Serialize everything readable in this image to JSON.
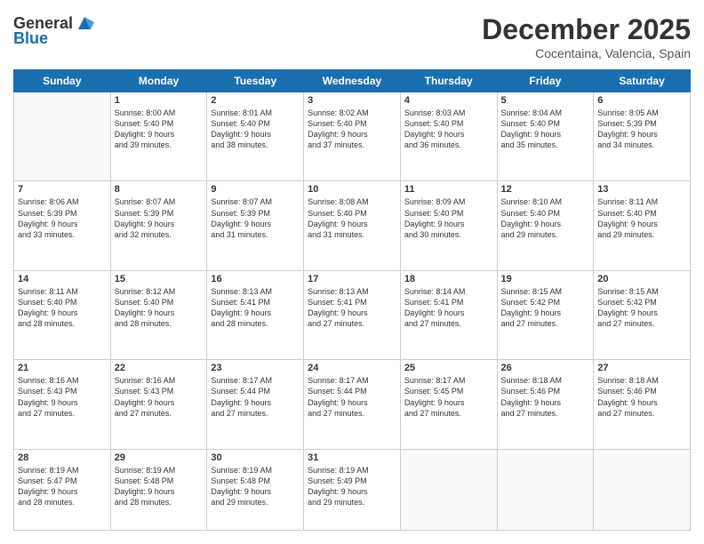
{
  "header": {
    "logo_general": "General",
    "logo_blue": "Blue",
    "month_title": "December 2025",
    "location": "Cocentaina, Valencia, Spain"
  },
  "days_of_week": [
    "Sunday",
    "Monday",
    "Tuesday",
    "Wednesday",
    "Thursday",
    "Friday",
    "Saturday"
  ],
  "weeks": [
    [
      {
        "day": "",
        "info": ""
      },
      {
        "day": "1",
        "info": "Sunrise: 8:00 AM\nSunset: 5:40 PM\nDaylight: 9 hours\nand 39 minutes."
      },
      {
        "day": "2",
        "info": "Sunrise: 8:01 AM\nSunset: 5:40 PM\nDaylight: 9 hours\nand 38 minutes."
      },
      {
        "day": "3",
        "info": "Sunrise: 8:02 AM\nSunset: 5:40 PM\nDaylight: 9 hours\nand 37 minutes."
      },
      {
        "day": "4",
        "info": "Sunrise: 8:03 AM\nSunset: 5:40 PM\nDaylight: 9 hours\nand 36 minutes."
      },
      {
        "day": "5",
        "info": "Sunrise: 8:04 AM\nSunset: 5:40 PM\nDaylight: 9 hours\nand 35 minutes."
      },
      {
        "day": "6",
        "info": "Sunrise: 8:05 AM\nSunset: 5:39 PM\nDaylight: 9 hours\nand 34 minutes."
      }
    ],
    [
      {
        "day": "7",
        "info": "Sunrise: 8:06 AM\nSunset: 5:39 PM\nDaylight: 9 hours\nand 33 minutes."
      },
      {
        "day": "8",
        "info": "Sunrise: 8:07 AM\nSunset: 5:39 PM\nDaylight: 9 hours\nand 32 minutes."
      },
      {
        "day": "9",
        "info": "Sunrise: 8:07 AM\nSunset: 5:39 PM\nDaylight: 9 hours\nand 31 minutes."
      },
      {
        "day": "10",
        "info": "Sunrise: 8:08 AM\nSunset: 5:40 PM\nDaylight: 9 hours\nand 31 minutes."
      },
      {
        "day": "11",
        "info": "Sunrise: 8:09 AM\nSunset: 5:40 PM\nDaylight: 9 hours\nand 30 minutes."
      },
      {
        "day": "12",
        "info": "Sunrise: 8:10 AM\nSunset: 5:40 PM\nDaylight: 9 hours\nand 29 minutes."
      },
      {
        "day": "13",
        "info": "Sunrise: 8:11 AM\nSunset: 5:40 PM\nDaylight: 9 hours\nand 29 minutes."
      }
    ],
    [
      {
        "day": "14",
        "info": "Sunrise: 8:11 AM\nSunset: 5:40 PM\nDaylight: 9 hours\nand 28 minutes."
      },
      {
        "day": "15",
        "info": "Sunrise: 8:12 AM\nSunset: 5:40 PM\nDaylight: 9 hours\nand 28 minutes."
      },
      {
        "day": "16",
        "info": "Sunrise: 8:13 AM\nSunset: 5:41 PM\nDaylight: 9 hours\nand 28 minutes."
      },
      {
        "day": "17",
        "info": "Sunrise: 8:13 AM\nSunset: 5:41 PM\nDaylight: 9 hours\nand 27 minutes."
      },
      {
        "day": "18",
        "info": "Sunrise: 8:14 AM\nSunset: 5:41 PM\nDaylight: 9 hours\nand 27 minutes."
      },
      {
        "day": "19",
        "info": "Sunrise: 8:15 AM\nSunset: 5:42 PM\nDaylight: 9 hours\nand 27 minutes."
      },
      {
        "day": "20",
        "info": "Sunrise: 8:15 AM\nSunset: 5:42 PM\nDaylight: 9 hours\nand 27 minutes."
      }
    ],
    [
      {
        "day": "21",
        "info": "Sunrise: 8:16 AM\nSunset: 5:43 PM\nDaylight: 9 hours\nand 27 minutes."
      },
      {
        "day": "22",
        "info": "Sunrise: 8:16 AM\nSunset: 5:43 PM\nDaylight: 9 hours\nand 27 minutes."
      },
      {
        "day": "23",
        "info": "Sunrise: 8:17 AM\nSunset: 5:44 PM\nDaylight: 9 hours\nand 27 minutes."
      },
      {
        "day": "24",
        "info": "Sunrise: 8:17 AM\nSunset: 5:44 PM\nDaylight: 9 hours\nand 27 minutes."
      },
      {
        "day": "25",
        "info": "Sunrise: 8:17 AM\nSunset: 5:45 PM\nDaylight: 9 hours\nand 27 minutes."
      },
      {
        "day": "26",
        "info": "Sunrise: 8:18 AM\nSunset: 5:46 PM\nDaylight: 9 hours\nand 27 minutes."
      },
      {
        "day": "27",
        "info": "Sunrise: 8:18 AM\nSunset: 5:46 PM\nDaylight: 9 hours\nand 27 minutes."
      }
    ],
    [
      {
        "day": "28",
        "info": "Sunrise: 8:19 AM\nSunset: 5:47 PM\nDaylight: 9 hours\nand 28 minutes."
      },
      {
        "day": "29",
        "info": "Sunrise: 8:19 AM\nSunset: 5:48 PM\nDaylight: 9 hours\nand 28 minutes."
      },
      {
        "day": "30",
        "info": "Sunrise: 8:19 AM\nSunset: 5:48 PM\nDaylight: 9 hours\nand 29 minutes."
      },
      {
        "day": "31",
        "info": "Sunrise: 8:19 AM\nSunset: 5:49 PM\nDaylight: 9 hours\nand 29 minutes."
      },
      {
        "day": "",
        "info": ""
      },
      {
        "day": "",
        "info": ""
      },
      {
        "day": "",
        "info": ""
      }
    ]
  ]
}
